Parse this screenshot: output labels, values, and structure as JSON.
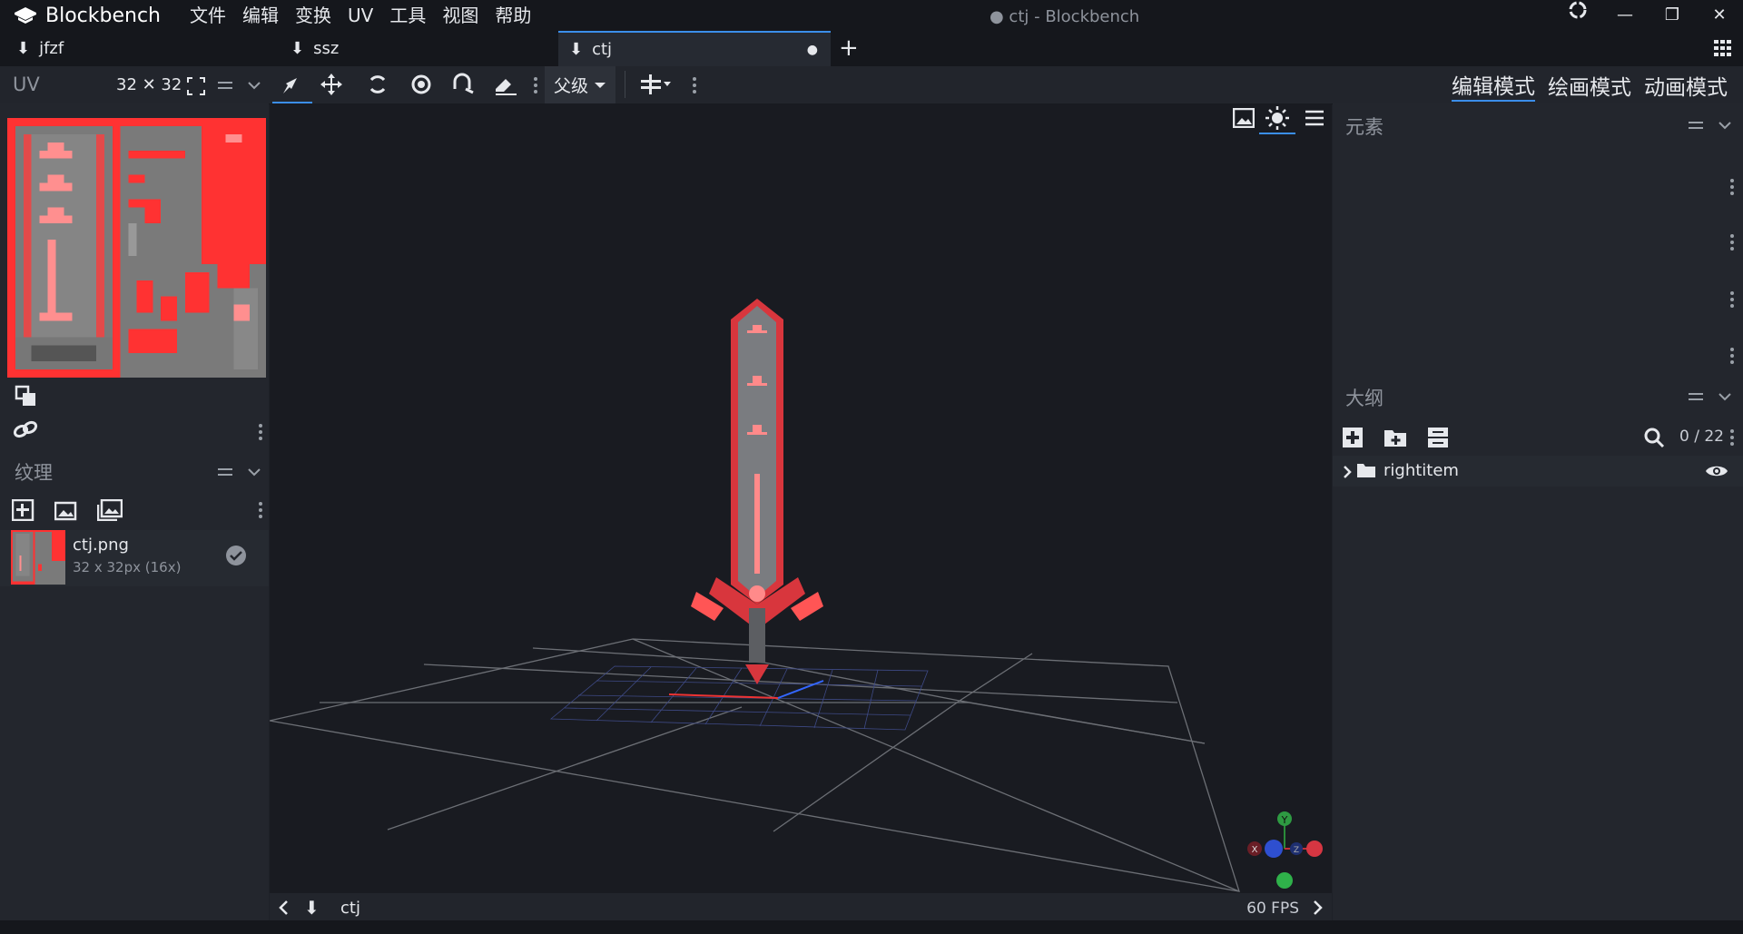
{
  "app": {
    "name": "Blockbench",
    "window_title": "● ctj - Blockbench"
  },
  "menu": [
    "文件",
    "编辑",
    "变换",
    "UV",
    "工具",
    "视图",
    "帮助"
  ],
  "tabs": [
    {
      "label": "jfzf",
      "active": false
    },
    {
      "label": "ssz",
      "active": false
    },
    {
      "label": "ctj",
      "active": true,
      "modified": "●"
    }
  ],
  "toolbar": {
    "dropdown": "父级",
    "modes": [
      "编辑模式",
      "绘画模式",
      "动画模式"
    ],
    "active_mode": "编辑模式"
  },
  "uv_panel": {
    "title": "UV",
    "size": "32 ✕ 32"
  },
  "texture_panel": {
    "title": "纹理",
    "file_name": "ctj.png",
    "file_info": "32 x 32px (16x)"
  },
  "element_panel": {
    "title": "元素"
  },
  "outline_panel": {
    "title": "大纲",
    "count": "0 / 22",
    "root": "rightitem"
  },
  "statusbar": {
    "model": "ctj",
    "fps": "60 FPS"
  },
  "gizmo": {
    "labels": [
      "Y",
      "X",
      "Z"
    ]
  },
  "colors": {
    "accent": "#3b8eea",
    "texture_red": "#ff3030",
    "bg": "#1e2128"
  }
}
